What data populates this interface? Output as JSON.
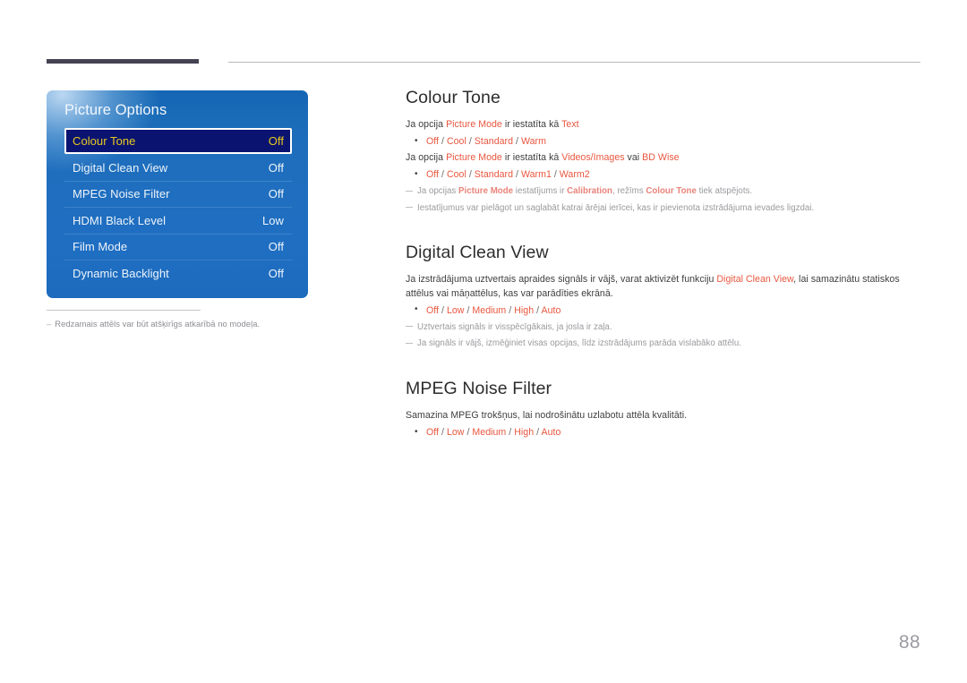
{
  "page": {
    "number": "88"
  },
  "osd": {
    "title": "Picture Options",
    "rows": [
      {
        "label": "Colour Tone",
        "value": "Off",
        "selected": true
      },
      {
        "label": "Digital Clean View",
        "value": "Off",
        "selected": false
      },
      {
        "label": "MPEG Noise Filter",
        "value": "Off",
        "selected": false
      },
      {
        "label": "HDMI Black Level",
        "value": "Low",
        "selected": false
      },
      {
        "label": "Film Mode",
        "value": "Off",
        "selected": false
      },
      {
        "label": "Dynamic Backlight",
        "value": "Off",
        "selected": false
      }
    ],
    "footnote_dash": "–",
    "footnote": "Redzamais attēls var būt atšķirīgs atkarībā no modeļa."
  },
  "colour_tone": {
    "title": "Colour Tone",
    "p1_a": "Ja opcija ",
    "p1_hl1": "Picture Mode",
    "p1_b": " ir iestatīta kā ",
    "p1_hl2": "Text",
    "opts1": "Off / Cool / Standard / Warm",
    "p2_a": "Ja opcija ",
    "p2_hl1": "Picture Mode",
    "p2_b": " ir iestatīta kā ",
    "p2_hl2": "Videos/Images",
    "p2_c": " vai ",
    "p2_hl3": "BD Wise",
    "opts2": "Off / Cool / Standard / Warm1 / Warm2",
    "note1_a": "Ja opcijas ",
    "note1_hl1": "Picture Mode",
    "note1_b": " iestatījums ir ",
    "note1_hl2": "Calibration",
    "note1_c": ", režīms ",
    "note1_hl3": "Colour Tone",
    "note1_d": " tiek atspējots.",
    "note2": "Iestatījumus var pielāgot un saglabāt katrai ārējai ierīcei, kas ir pievienota izstrādājuma ievades ligzdai."
  },
  "digital_clean_view": {
    "title": "Digital Clean View",
    "p1_a": "Ja izstrādājuma uztvertais apraides signāls ir vājš, varat aktivizēt funkciju ",
    "p1_hl": "Digital Clean View",
    "p1_b": ", lai samazinātu statiskos attēlus vai māņattēlus, kas var parādīties ekrānā.",
    "opts": "Off / Low / Medium / High / Auto",
    "note1": "Uztvertais signāls ir visspēcīgākais, ja josla ir zaļa.",
    "note2": "Ja signāls ir vājš, izmēģiniet visas opcijas, līdz izstrādājums parāda vislabāko attēlu."
  },
  "mpeg_noise_filter": {
    "title": "MPEG Noise Filter",
    "p1": "Samazina MPEG trokšņus, lai nodrošinātu uzlabotu attēla kvalitāti.",
    "opts": "Off / Low / Medium / High / Auto"
  },
  "colors": {
    "accent": "#e8573f",
    "osd_blue": "#1f6ebe",
    "osd_selected_bg": "#0a1470",
    "osd_selected_text": "#e8c81e",
    "header_bar": "#454254"
  }
}
